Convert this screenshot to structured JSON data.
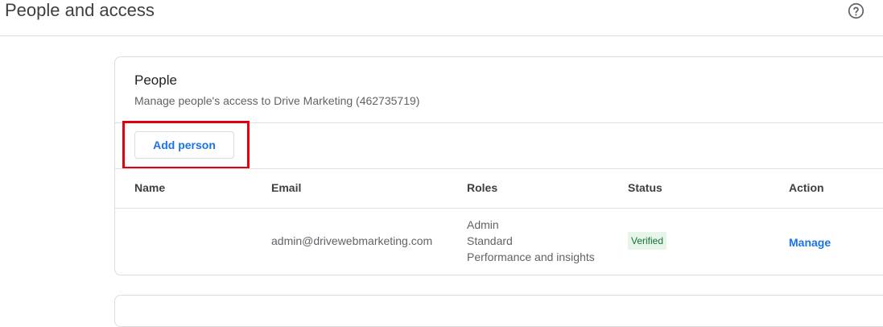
{
  "header": {
    "title": "People and access",
    "help_icon": "help-circle-icon"
  },
  "people_card": {
    "title": "People",
    "subtitle": "Manage people's access to Drive Marketing (462735719)",
    "add_button_label": "Add person",
    "columns": {
      "name": "Name",
      "email": "Email",
      "roles": "Roles",
      "status": "Status",
      "action": "Action"
    },
    "rows": [
      {
        "name": "",
        "email": "admin@drivewebmarketing.com",
        "roles": [
          "Admin",
          "Standard",
          "Performance and insights"
        ],
        "status": "Verified",
        "action": "Manage"
      }
    ]
  },
  "colors": {
    "accent": "#1a73e8",
    "highlight_box": "#e0000f",
    "verified_bg": "#e6f4ea",
    "verified_text": "#137333"
  }
}
